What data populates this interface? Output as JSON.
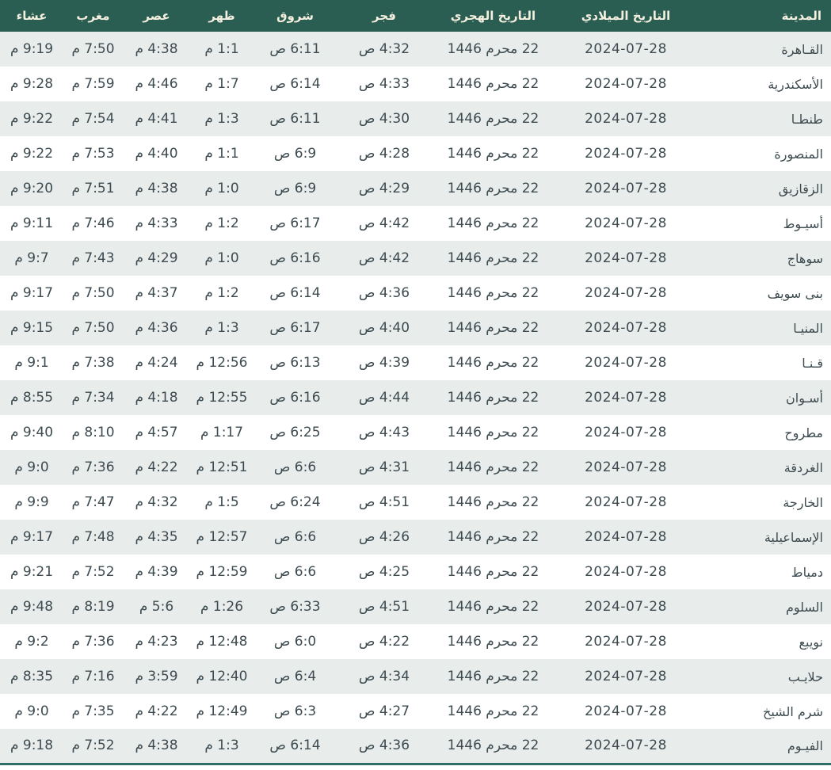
{
  "colors": {
    "header_bg": "#2b5e52",
    "header_text": "#f4efdf",
    "row_alt_bg": "#e8eceb",
    "row_bg": "#ffffff",
    "cell_text": "#3d4b50",
    "bottom_border": "#2f6f66"
  },
  "table": {
    "columns": [
      {
        "key": "city",
        "label": "المدينة"
      },
      {
        "key": "gregorian",
        "label": "التاريخ الميلادي"
      },
      {
        "key": "hijri",
        "label": "التاريخ الهجري"
      },
      {
        "key": "fajr",
        "label": "فجر"
      },
      {
        "key": "shurooq",
        "label": "شروق"
      },
      {
        "key": "dhuhr",
        "label": "ظهر"
      },
      {
        "key": "asr",
        "label": "عصر"
      },
      {
        "key": "maghrib",
        "label": "مغرب"
      },
      {
        "key": "isha",
        "label": "عشاء"
      }
    ],
    "rows": [
      {
        "city": "القـاهرة",
        "gregorian": "2024-07-28",
        "hijri": "22 محرم 1446",
        "fajr": "4:32 ص",
        "shurooq": "6:11 ص",
        "dhuhr": "1:1 م",
        "asr": "4:38 م",
        "maghrib": "7:50 م",
        "isha": "9:19 م"
      },
      {
        "city": "الأسكندرية",
        "gregorian": "2024-07-28",
        "hijri": "22 محرم 1446",
        "fajr": "4:33 ص",
        "shurooq": "6:14 ص",
        "dhuhr": "1:7 م",
        "asr": "4:46 م",
        "maghrib": "7:59 م",
        "isha": "9:28 م"
      },
      {
        "city": "طنطـا",
        "gregorian": "2024-07-28",
        "hijri": "22 محرم 1446",
        "fajr": "4:30 ص",
        "shurooq": "6:11 ص",
        "dhuhr": "1:3 م",
        "asr": "4:41 م",
        "maghrib": "7:54 م",
        "isha": "9:22 م"
      },
      {
        "city": "المنصورة",
        "gregorian": "2024-07-28",
        "hijri": "22 محرم 1446",
        "fajr": "4:28 ص",
        "shurooq": "6:9 ص",
        "dhuhr": "1:1 م",
        "asr": "4:40 م",
        "maghrib": "7:53 م",
        "isha": "9:22 م"
      },
      {
        "city": "الزقازيق",
        "gregorian": "2024-07-28",
        "hijri": "22 محرم 1446",
        "fajr": "4:29 ص",
        "shurooq": "6:9 ص",
        "dhuhr": "1:0 م",
        "asr": "4:38 م",
        "maghrib": "7:51 م",
        "isha": "9:20 م"
      },
      {
        "city": "أسيـوط",
        "gregorian": "2024-07-28",
        "hijri": "22 محرم 1446",
        "fajr": "4:42 ص",
        "shurooq": "6:17 ص",
        "dhuhr": "1:2 م",
        "asr": "4:33 م",
        "maghrib": "7:46 م",
        "isha": "9:11 م"
      },
      {
        "city": "سوهاج",
        "gregorian": "2024-07-28",
        "hijri": "22 محرم 1446",
        "fajr": "4:42 ص",
        "shurooq": "6:16 ص",
        "dhuhr": "1:0 م",
        "asr": "4:29 م",
        "maghrib": "7:43 م",
        "isha": "9:7 م"
      },
      {
        "city": "بنى سويف",
        "gregorian": "2024-07-28",
        "hijri": "22 محرم 1446",
        "fajr": "4:36 ص",
        "shurooq": "6:14 ص",
        "dhuhr": "1:2 م",
        "asr": "4:37 م",
        "maghrib": "7:50 م",
        "isha": "9:17 م"
      },
      {
        "city": "المنيـا",
        "gregorian": "2024-07-28",
        "hijri": "22 محرم 1446",
        "fajr": "4:40 ص",
        "shurooq": "6:17 ص",
        "dhuhr": "1:3 م",
        "asr": "4:36 م",
        "maghrib": "7:50 م",
        "isha": "9:15 م"
      },
      {
        "city": "قـنـا",
        "gregorian": "2024-07-28",
        "hijri": "22 محرم 1446",
        "fajr": "4:39 ص",
        "shurooq": "6:13 ص",
        "dhuhr": "12:56 م",
        "asr": "4:24 م",
        "maghrib": "7:38 م",
        "isha": "9:1 م"
      },
      {
        "city": "أسـوان",
        "gregorian": "2024-07-28",
        "hijri": "22 محرم 1446",
        "fajr": "4:44 ص",
        "shurooq": "6:16 ص",
        "dhuhr": "12:55 م",
        "asr": "4:18 م",
        "maghrib": "7:34 م",
        "isha": "8:55 م"
      },
      {
        "city": "مطروح",
        "gregorian": "2024-07-28",
        "hijri": "22 محرم 1446",
        "fajr": "4:43 ص",
        "shurooq": "6:25 ص",
        "dhuhr": "1:17 م",
        "asr": "4:57 م",
        "maghrib": "8:10 م",
        "isha": "9:40 م"
      },
      {
        "city": "الغردقة",
        "gregorian": "2024-07-28",
        "hijri": "22 محرم 1446",
        "fajr": "4:31 ص",
        "shurooq": "6:6 ص",
        "dhuhr": "12:51 م",
        "asr": "4:22 م",
        "maghrib": "7:36 م",
        "isha": "9:0 م"
      },
      {
        "city": "الخارجة",
        "gregorian": "2024-07-28",
        "hijri": "22 محرم 1446",
        "fajr": "4:51 ص",
        "shurooq": "6:24 ص",
        "dhuhr": "1:5 م",
        "asr": "4:32 م",
        "maghrib": "7:47 م",
        "isha": "9:9 م"
      },
      {
        "city": "الإسماعيلية",
        "gregorian": "2024-07-28",
        "hijri": "22 محرم 1446",
        "fajr": "4:26 ص",
        "shurooq": "6:6 ص",
        "dhuhr": "12:57 م",
        "asr": "4:35 م",
        "maghrib": "7:48 م",
        "isha": "9:17 م"
      },
      {
        "city": "دمياط",
        "gregorian": "2024-07-28",
        "hijri": "22 محرم 1446",
        "fajr": "4:25 ص",
        "shurooq": "6:6 ص",
        "dhuhr": "12:59 م",
        "asr": "4:39 م",
        "maghrib": "7:52 م",
        "isha": "9:21 م"
      },
      {
        "city": "السلوم",
        "gregorian": "2024-07-28",
        "hijri": "22 محرم 1446",
        "fajr": "4:51 ص",
        "shurooq": "6:33 ص",
        "dhuhr": "1:26 م",
        "asr": "5:6 م",
        "maghrib": "8:19 م",
        "isha": "9:48 م"
      },
      {
        "city": "نويبع",
        "gregorian": "2024-07-28",
        "hijri": "22 محرم 1446",
        "fajr": "4:22 ص",
        "shurooq": "6:0 ص",
        "dhuhr": "12:48 م",
        "asr": "4:23 م",
        "maghrib": "7:36 م",
        "isha": "9:2 م"
      },
      {
        "city": "حلايـب",
        "gregorian": "2024-07-28",
        "hijri": "22 محرم 1446",
        "fajr": "4:34 ص",
        "shurooq": "6:4 ص",
        "dhuhr": "12:40 م",
        "asr": "3:59 م",
        "maghrib": "7:16 م",
        "isha": "8:35 م"
      },
      {
        "city": "شرم الشيخ",
        "gregorian": "2024-07-28",
        "hijri": "22 محرم 1446",
        "fajr": "4:27 ص",
        "shurooq": "6:3 ص",
        "dhuhr": "12:49 م",
        "asr": "4:22 م",
        "maghrib": "7:35 م",
        "isha": "9:0 م"
      },
      {
        "city": "الفيـوم",
        "gregorian": "2024-07-28",
        "hijri": "22 محرم 1446",
        "fajr": "4:36 ص",
        "shurooq": "6:14 ص",
        "dhuhr": "1:3 م",
        "asr": "4:38 م",
        "maghrib": "7:52 م",
        "isha": "9:18 م"
      }
    ]
  }
}
